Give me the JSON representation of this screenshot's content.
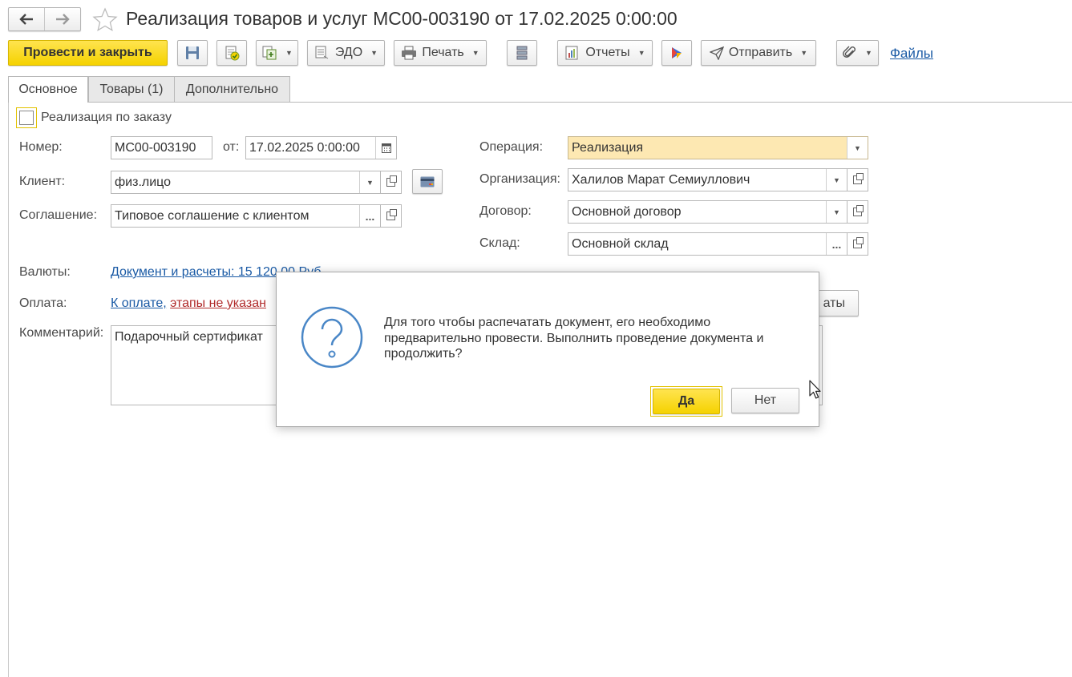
{
  "window": {
    "title": "Реализация товаров и услуг МС00-003190 от 17.02.2025 0:00:00"
  },
  "toolbar": {
    "post_close_label": "Провести и закрыть",
    "edo_label": "ЭДО",
    "print_label": "Печать",
    "reports_label": "Отчеты",
    "send_label": "Отправить",
    "files_label": "Файлы"
  },
  "tabs": [
    {
      "label": "Основное"
    },
    {
      "label": "Товары (1)"
    },
    {
      "label": "Дополнительно"
    }
  ],
  "form": {
    "by_order_label": "Реализация по заказу",
    "number_label": "Номер:",
    "number_value": "МС00-003190",
    "from_label": "от:",
    "date_value": "17.02.2025  0:00:00",
    "client_label": "Клиент:",
    "client_value": "физ.лицо",
    "agreement_label": "Соглашение:",
    "agreement_value": "Типовое соглашение с клиентом",
    "operation_label": "Операция:",
    "operation_value": "Реализация",
    "organization_label": "Организация:",
    "organization_value": "Халилов Марат Семиуллович",
    "contract_label": "Договор:",
    "contract_value": "Основной договор",
    "warehouse_label": "Склад:",
    "warehouse_value": "Основной склад",
    "currency_label": "Валюты:",
    "currency_link": "Документ и расчеты: 15 120,00 Руб",
    "payment_label": "Оплата:",
    "payment_link": "К оплате,",
    "payment_warning": "этапы не указан",
    "payment_button_fragment": "аты",
    "comment_label": "Комментарий:",
    "comment_value": "Подарочный сертификат"
  },
  "dialog": {
    "message": "Для того чтобы распечатать документ, его необходимо предварительно провести. Выполнить проведение документа и продолжить?",
    "yes_label": "Да",
    "no_label": "Нет"
  },
  "colors": {
    "accent_yellow": "#f5d200",
    "operation_field_bg": "#fde8b2",
    "link_blue": "#1a5aa5",
    "warning_red": "#b02a2a"
  }
}
